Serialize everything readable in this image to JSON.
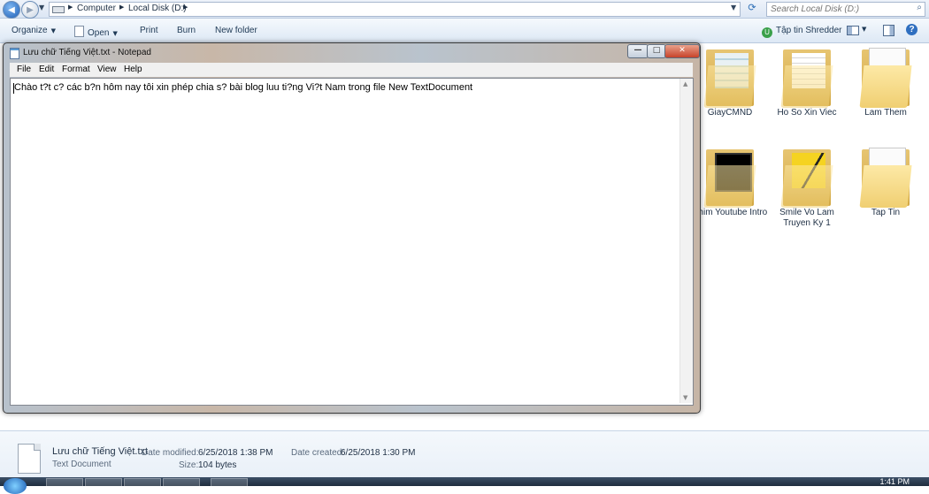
{
  "explorer": {
    "address": {
      "breadcrumbs": [
        "Computer",
        "Local Disk (D:)"
      ],
      "search_placeholder": "Search Local Disk (D:)"
    },
    "toolbar": {
      "organize": "Organize",
      "open": "Open",
      "print": "Print",
      "burn": "Burn",
      "new_folder": "New folder",
      "shredder": "Tập tin Shredder"
    },
    "folders": [
      {
        "label": "GiayCMND",
        "icon": "folder-document-icon"
      },
      {
        "label": "Ho So Xin Viec",
        "icon": "folder-document-icon"
      },
      {
        "label": "Lam Them",
        "icon": "folder-icon"
      },
      {
        "label": "Phim Youtube Intro",
        "icon": "folder-video-icon"
      },
      {
        "label": "Smile Vo Lam Truyen Ky 1",
        "icon": "folder-image-icon"
      },
      {
        "label": "Tap Tin",
        "icon": "folder-icon"
      }
    ],
    "details": {
      "file_name": "Lưu chữ Tiếng Việt.txt",
      "file_type": "Text Document",
      "date_modified_label": "Date modified:",
      "date_modified": "6/25/2018 1:38 PM",
      "date_created_label": "Date created:",
      "date_created": "6/25/2018 1:30 PM",
      "size_label": "Size:",
      "size": "104 bytes"
    },
    "taskbar": {
      "clock": "1:41 PM"
    }
  },
  "notepad": {
    "title": "Lưu chữ Tiếng Việt.txt - Notepad",
    "menu": [
      "File",
      "Edit",
      "Format",
      "View",
      "Help"
    ],
    "content": "Chào t?t c? các b?n hôm nay tôi xin phép chia s? bài blog luu ti?ng Vi?t Nam trong file New TextDocument"
  },
  "colors": {
    "explorer_bar": "#dce6f4",
    "notepad_frame": "#c8b7a8",
    "close_button": "#c7432a"
  }
}
